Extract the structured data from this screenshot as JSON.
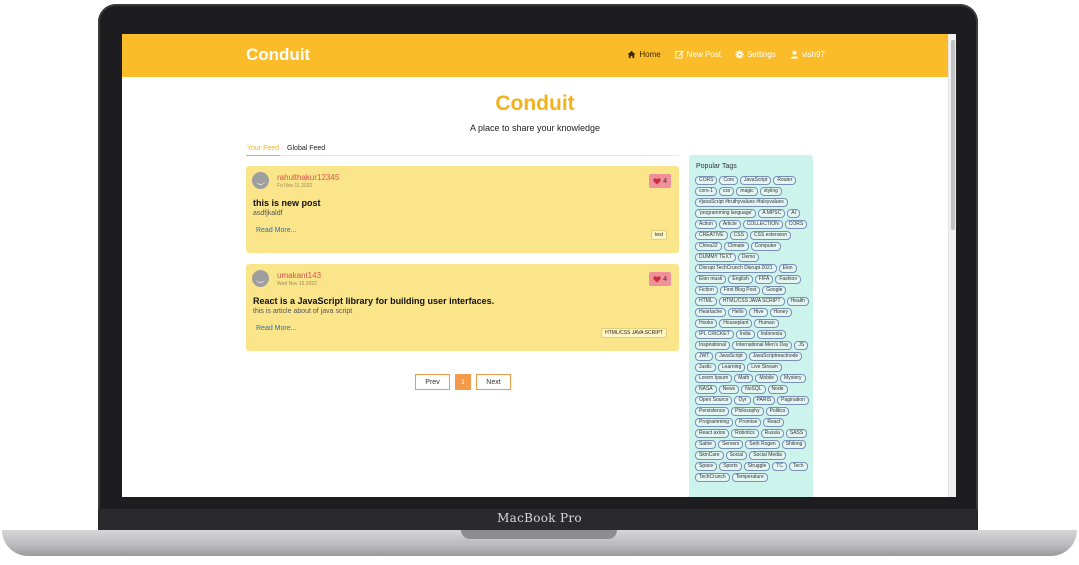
{
  "device": {
    "label": "MacBook Pro"
  },
  "navbar": {
    "brand": "Conduit",
    "links": [
      {
        "label": "Home",
        "icon": "home-icon",
        "active": true
      },
      {
        "label": "New Post",
        "icon": "edit-icon",
        "active": false
      },
      {
        "label": "Settings",
        "icon": "gear-icon",
        "active": false
      },
      {
        "label": "vish97",
        "icon": "user-icon",
        "active": false
      }
    ]
  },
  "hero": {
    "title": "Conduit",
    "subtitle": "A place to share your knowledge"
  },
  "feed": {
    "tabs": [
      {
        "label": "Your Feed",
        "active": true
      },
      {
        "label": "Global Feed",
        "active": false
      }
    ],
    "articles": [
      {
        "author": "rahulthakur12345",
        "date": "Fri Nov 11 2022",
        "likes": "4",
        "title": "this is new post",
        "description": "asdfjkaldf",
        "read_more": "Read More...",
        "tag": "test"
      },
      {
        "author": "umakant143",
        "date": "Wed Nov 16 2022",
        "likes": "4",
        "title": "React is a JavaScript library for building user interfaces.",
        "description": "this is article about of java script",
        "read_more": "Read More...",
        "tag": "HTML/CSS JAVA SCRIPT"
      }
    ]
  },
  "pagination": {
    "prev": "Prev",
    "current": "1",
    "next": "Next"
  },
  "sidebar": {
    "title": "Popular Tags",
    "tags": [
      "CORS",
      "Cors",
      "JavaScript",
      "Router",
      "cors-1",
      "css",
      "magic",
      "styling",
      "#javaScript #truthyvalues #falsyvalues",
      "'programming language'",
      "A MPSC",
      "AI",
      "Action",
      "Article",
      "COLLECTION",
      "CORS",
      "CREATIVE",
      "CSS",
      "CSS extension",
      "China22",
      "Climate",
      "Computer",
      "DUMMY TEXT",
      "Demo",
      "Disrupt TechCrunch Disrupt 2021",
      "Elon",
      "Elon musk",
      "English",
      "FIFA",
      "Fashion",
      "Fiction",
      "First Blog Post",
      "Google",
      "HTML",
      "HTML/CSS JAVA SCRIPT",
      "Health",
      "Heartache",
      "Hello",
      "Hive",
      "Honey",
      "Hooks",
      "Houseplant",
      "Human",
      "IPL CRICKET",
      "India",
      "Indonesia",
      "Inspirational",
      "International Men's Day",
      "JS",
      "JWT",
      "JavaScript",
      "JavaScriptreactnode",
      "Justic",
      "Learning",
      "Live Stream",
      "Lorem Ipsum",
      "Math",
      "Mobile",
      "Mystery",
      "NASA",
      "News",
      "NoSQL",
      "Node",
      "Open Source",
      "Oyr",
      "PARIS",
      "Pagination",
      "Persistence",
      "Philosophy",
      "Politics",
      "Programming",
      "Promise",
      "React",
      "React axios",
      "Robotics",
      "Russia",
      "SASS",
      "Satire",
      "Servers",
      "Seth Rogen",
      "Shilong",
      "SkinCare",
      "Social",
      "Social Media",
      "Space",
      "Sports",
      "Struggle",
      "TC",
      "Tech",
      "TechCrunch",
      "Temperature"
    ]
  },
  "colors": {
    "navbar": "#fbbc2a",
    "brand_accent": "#f2b21c",
    "card_bg": "#fbe58a",
    "sidebar_bg": "#cdf4ec",
    "author": "#d9534f",
    "link": "#2f6db3",
    "pager_accent": "#f39a4a"
  }
}
